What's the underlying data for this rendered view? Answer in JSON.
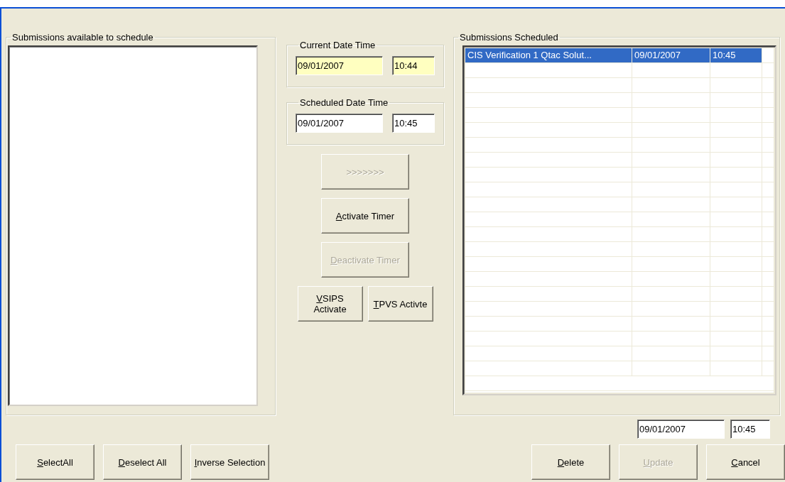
{
  "available": {
    "title": "Submissions available to schedule"
  },
  "current": {
    "title": "Current Date Time",
    "date": {
      "value": "09/01/2007",
      "readonly": true
    },
    "time": {
      "value": "10:44",
      "readonly": true
    }
  },
  "scheduled_time": {
    "title": "Scheduled Date Time",
    "date": {
      "value": "09/01/2007",
      "readonly": false
    },
    "time": {
      "value": "10:45",
      "readonly": false
    }
  },
  "middle_buttons": [
    {
      "label": ">>>>>>>",
      "disabled": true,
      "underline_first": false
    },
    {
      "label": "Activate Timer",
      "disabled": false,
      "underline_first": true
    },
    {
      "label": "Deactivate Timer",
      "disabled": true,
      "underline_first": true
    }
  ],
  "activate_buttons": [
    {
      "label": "VSIPS Activate",
      "disabled": false,
      "underline_first": true
    },
    {
      "label": "TPVS Activte",
      "disabled": false,
      "underline_first": true
    }
  ],
  "scheduled": {
    "title": "Submissions Scheduled",
    "rows": [
      {
        "cells": [
          "CIS Verification 1 Qtac Solut...",
          "09/01/2007",
          "10:45"
        ],
        "selected": true
      }
    ]
  },
  "edit": {
    "date": {
      "value": "09/01/2007",
      "readonly": false
    },
    "time": {
      "value": "10:45",
      "readonly": false
    }
  },
  "left_buttons": [
    {
      "label": "SelectAll",
      "disabled": false,
      "underline_first": true
    },
    {
      "label": "Deselect All",
      "disabled": false,
      "underline_first": true
    },
    {
      "label": "Inverse Selection",
      "disabled": false,
      "underline_first": true
    }
  ],
  "right_buttons": [
    {
      "label": "Delete",
      "disabled": false,
      "underline_first": true
    },
    {
      "label": "Update",
      "disabled": true,
      "underline_first": true
    },
    {
      "label": "Cancel",
      "disabled": false,
      "underline_first": true
    }
  ]
}
